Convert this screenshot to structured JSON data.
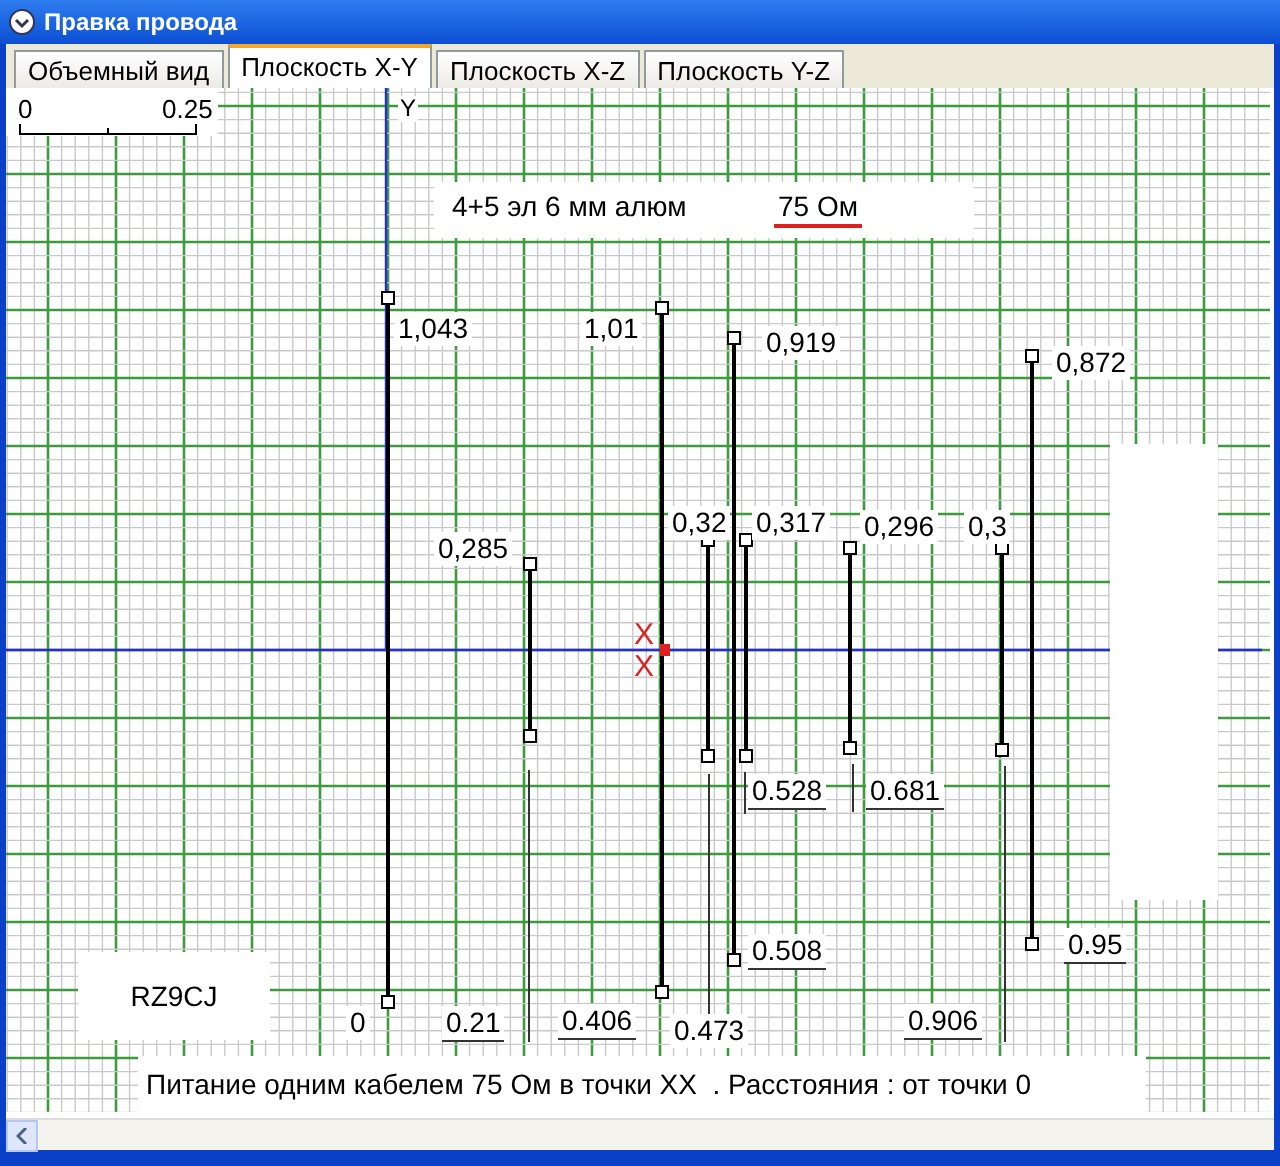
{
  "window": {
    "title": "Правка провода"
  },
  "tabs": [
    {
      "label": "Объемный вид",
      "selected": false
    },
    {
      "label": "Плоскость X-Y",
      "selected": true
    },
    {
      "label": "Плоскость X-Z",
      "selected": false
    },
    {
      "label": "Плоскость Y-Z",
      "selected": false
    }
  ],
  "scale": {
    "start": "0",
    "end": "0.25"
  },
  "axis_label": "Y",
  "caption": {
    "text": "4+5 эл 6 мм алюм",
    "impedance": "75 Ом"
  },
  "feed_marks": [
    "X",
    "X"
  ],
  "wires": [
    {
      "height_label": "1,043",
      "distance_label": "0"
    },
    {
      "height_label": "0,285",
      "distance_label": "0.21"
    },
    {
      "height_label": "1,01",
      "distance_label": "0.406"
    },
    {
      "height_label": "0,32",
      "distance_label": "0.473"
    },
    {
      "height_label": "0,919",
      "distance_label": "0.508"
    },
    {
      "height_label": "0,317",
      "distance_label": "0.528"
    },
    {
      "height_label": "0,296",
      "distance_label": "0.681"
    },
    {
      "height_label": "0,3",
      "distance_label": "0.906"
    },
    {
      "height_label": "0,872",
      "distance_label": "0.95"
    }
  ],
  "callsign": "RZ9CJ",
  "footer": "Питание одним кабелем 75 Ом в точки XX  . Расстояния : от точки 0"
}
